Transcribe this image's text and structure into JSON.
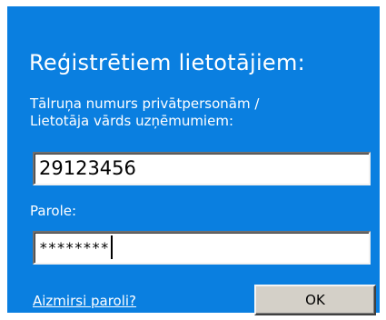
{
  "login": {
    "title": "Reģistrētiem lietotājiem:",
    "username_label_line1": "Tālruņa numurs privātpersonām /",
    "username_label_line2": "Lietotāja vārds uzņēmumiem:",
    "username_value": "29123456",
    "password_label": "Parole:",
    "password_value": "********",
    "forgot_link": "Aizmirsi paroli?",
    "ok_label": "OK"
  },
  "colors": {
    "panel_background": "#0a7fe0",
    "text": "#ffffff",
    "button_face": "#d4d0c8"
  }
}
